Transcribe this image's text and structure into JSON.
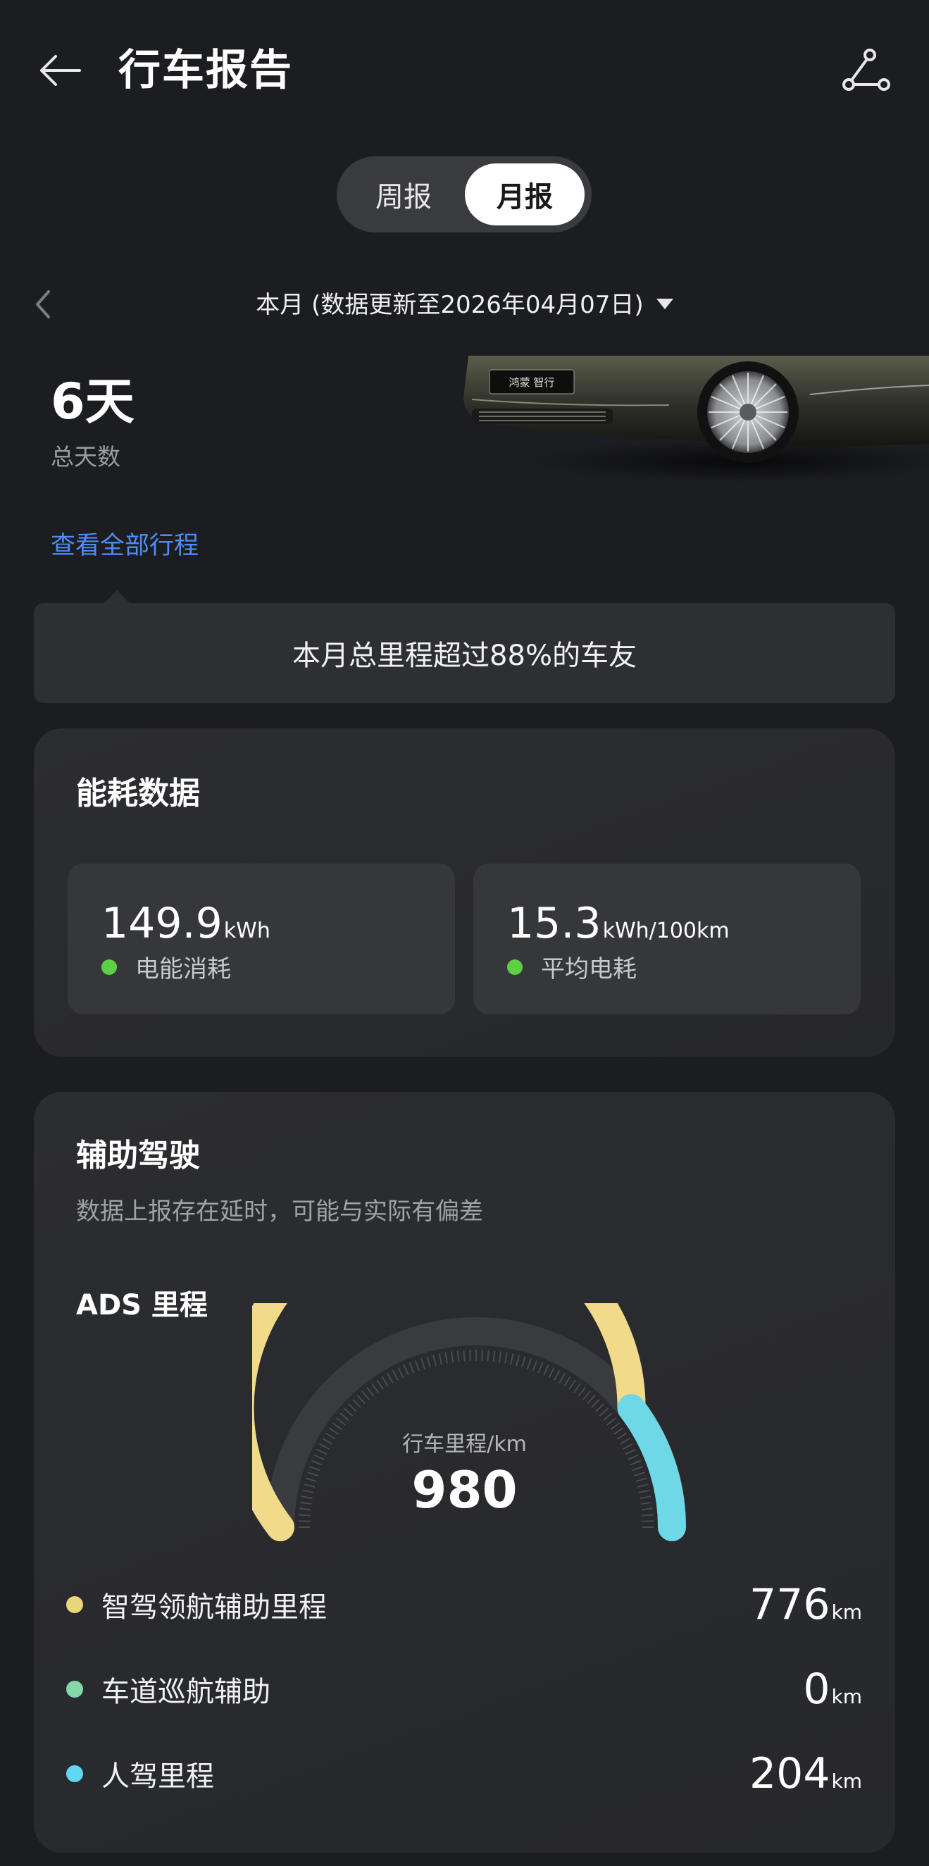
{
  "header": {
    "title": "行车报告",
    "back_icon": "arrow-left-icon",
    "share_icon": "share-icon"
  },
  "tabs": {
    "week": "周报",
    "month": "月报",
    "selected": "月报"
  },
  "period": {
    "label": "本月 (数据更新至2026年04月07日)",
    "prev_icon": "chevron-left-icon",
    "dropdown_icon": "triangle-down-icon"
  },
  "summary": {
    "days_value": "6天",
    "days_label": "总天数",
    "view_all": "查看全部行程",
    "car_badge": "鸿蒙 智行"
  },
  "banner": {
    "text": "本月总里程超过88%的车友"
  },
  "energy": {
    "title": "能耗数据",
    "items": [
      {
        "value": "149.9",
        "unit": "kWh",
        "label": "电能消耗",
        "dot_color": "#5fd046"
      },
      {
        "value": "15.3",
        "unit": "kWh/100km",
        "label": "平均电耗",
        "dot_color": "#5fd046"
      }
    ]
  },
  "assist": {
    "title": "辅助驾驶",
    "subtitle": "数据上报存在延时，可能与实际有偏差",
    "ads_title": "ADS 里程",
    "gauge": {
      "label": "行车里程/km",
      "total": "980",
      "segments": [
        {
          "value": 776,
          "color": "#f1db8a"
        },
        {
          "value": 0,
          "color": "#7bd6a4"
        },
        {
          "value": 204,
          "color": "#6fd8e6"
        }
      ]
    },
    "legend": [
      {
        "label": "智驾领航辅助里程",
        "value": "776",
        "unit": "km",
        "dot_color": "#ecd67a"
      },
      {
        "label": "车道巡航辅助",
        "value": "0",
        "unit": "km",
        "dot_color": "#82d8a8"
      },
      {
        "label": "人驾里程",
        "value": "204",
        "unit": "km",
        "dot_color": "#5fd8f2"
      }
    ]
  }
}
